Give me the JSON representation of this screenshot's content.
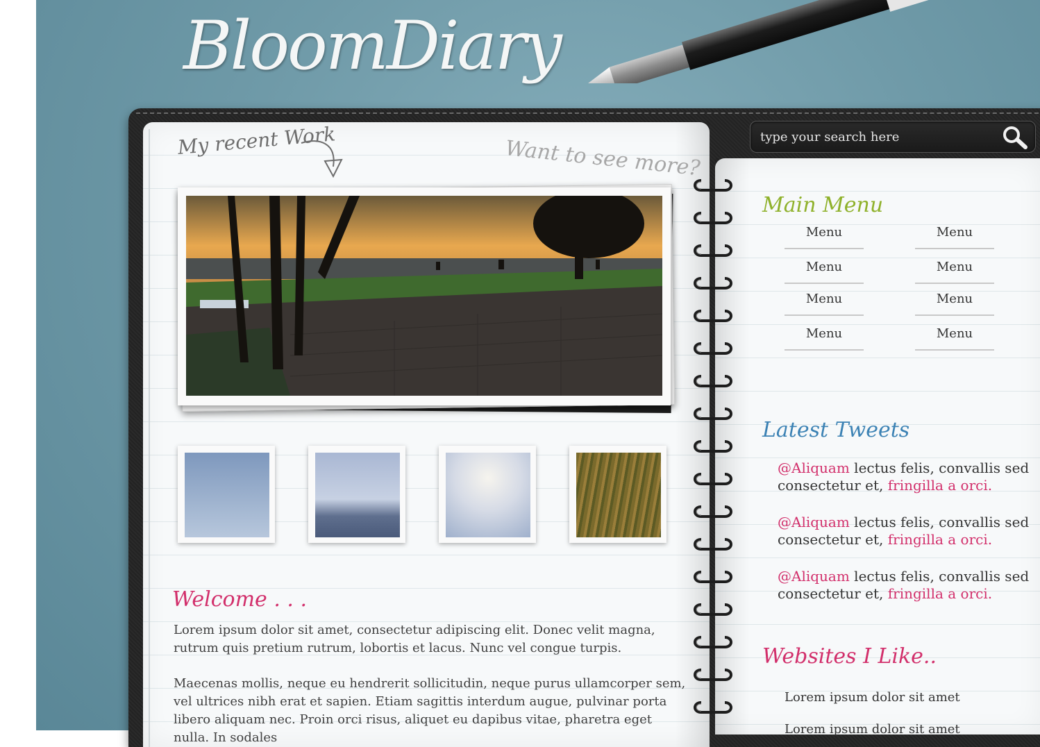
{
  "brand": {
    "logo": "BloomDiary"
  },
  "header": {
    "recent_label": "My recent Work",
    "more_link": "Want to see more?"
  },
  "search": {
    "placeholder": "type your search here"
  },
  "main_menu": {
    "title": "Main Menu",
    "items": [
      "Menu",
      "Menu",
      "Menu",
      "Menu",
      "Menu",
      "Menu",
      "Menu",
      "Menu"
    ]
  },
  "tweets": {
    "title": "Latest Tweets",
    "items": [
      {
        "handle": "@Aliquam",
        "text": " lectus felis, convallis sed consectetur et, ",
        "tag": "fringilla a orci."
      },
      {
        "handle": "@Aliquam",
        "text": " lectus felis, convallis sed consectetur et, ",
        "tag": "fringilla a orci."
      },
      {
        "handle": "@Aliquam",
        "text": " lectus felis, convallis sed consectetur et, ",
        "tag": "fringilla a orci."
      }
    ]
  },
  "websites": {
    "title": "Websites I Like..",
    "items": [
      "Lorem ipsum dolor sit amet",
      "Lorem ipsum dolor sit amet"
    ]
  },
  "welcome": {
    "title": "Welcome . . .",
    "paragraphs": [
      "Lorem ipsum dolor sit amet, consectetur adipiscing elit. Donec velit magna, rutrum quis pretium rutrum, lobortis et lacus. Nunc vel congue turpis.",
      "Maecenas mollis, neque eu hendrerit sollicitudin, neque purus ullamcorper sem, vel ultrices nibh erat et sapien. Etiam sagittis interdum augue, pulvinar porta libero aliquam nec. Proin orci risus, aliquet eu dapibus vitae, pharetra eget nulla. In sodales"
    ]
  },
  "colors": {
    "background": "#6f9aa8",
    "accent_pink": "#d22f6b",
    "menu_green": "#8fb12b",
    "tweets_blue": "#3c82b4",
    "leather": "#262626"
  },
  "icons": {
    "search": "magnifier-icon",
    "arrow": "curved-arrow-icon"
  }
}
